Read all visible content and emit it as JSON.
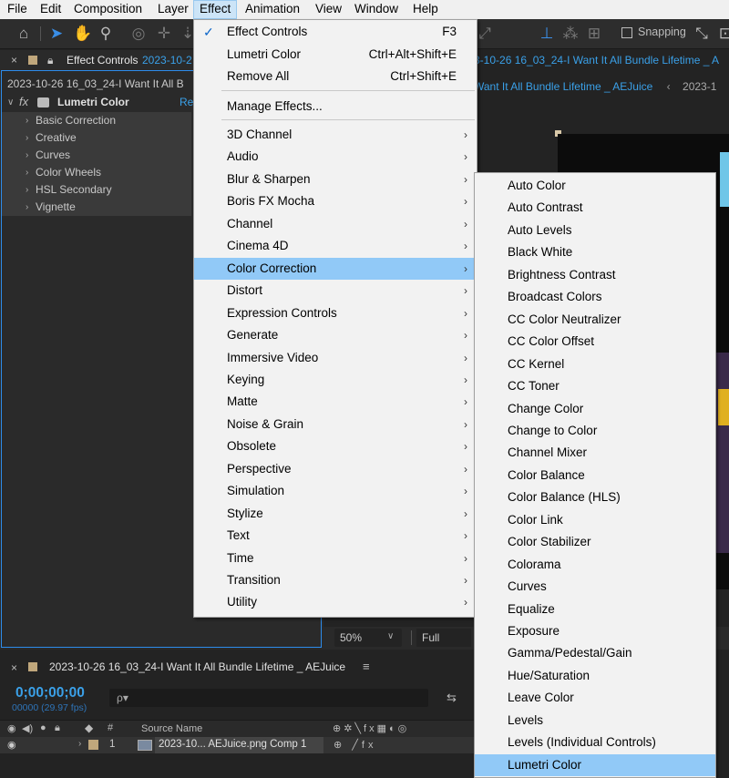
{
  "menubar": {
    "items": [
      "File",
      "Edit",
      "Composition",
      "Layer",
      "Effect",
      "Animation",
      "View",
      "Window",
      "Help"
    ],
    "active": "Effect"
  },
  "toolbar": {
    "snapping_label": "Snapping"
  },
  "effect_controls": {
    "tab_label": "Effect Controls",
    "tab_comp": "2023-10-2",
    "layer_path": "2023-10-26 16_03_24-I Want It All B",
    "fx_label": "fx",
    "effect_name": "Lumetri Color",
    "reset_label": "Re",
    "sections": [
      "Basic Correction",
      "Creative",
      "Curves",
      "Color Wheels",
      "HSL Secondary",
      "Vignette"
    ]
  },
  "composition": {
    "tab_label": "3-10-26 16_03_24-I Want It All Bundle Lifetime _ A",
    "breadcrumb": "Want It All Bundle Lifetime _ AEJuice",
    "breadcrumb_next": "2023-1",
    "zoom": "50%",
    "resolution": "Full"
  },
  "timeline": {
    "title": "2023-10-26 16_03_24-I Want It All Bundle Lifetime _ AEJuice",
    "timecode": "0;00;00;00",
    "frames": "00000 (29.97 fps)",
    "search_placeholder": "ρ▾",
    "col_source_name": "Source Name",
    "layer_index": "1",
    "layer_name": "2023-10... AEJuice.png Comp 1"
  },
  "effect_menu": {
    "top_items": [
      {
        "label": "Effect Controls",
        "shortcut": "F3",
        "checked": true
      },
      {
        "label": "Lumetri Color",
        "shortcut": "Ctrl+Alt+Shift+E"
      },
      {
        "label": "Remove All",
        "shortcut": "Ctrl+Shift+E"
      }
    ],
    "manage": "Manage Effects...",
    "categories": [
      "3D Channel",
      "Audio",
      "Blur & Sharpen",
      "Boris FX Mocha",
      "Channel",
      "Cinema 4D",
      "Color Correction",
      "Distort",
      "Expression Controls",
      "Generate",
      "Immersive Video",
      "Keying",
      "Matte",
      "Noise & Grain",
      "Obsolete",
      "Perspective",
      "Simulation",
      "Stylize",
      "Text",
      "Time",
      "Transition",
      "Utility"
    ],
    "highlighted": "Color Correction"
  },
  "color_correction_menu": {
    "items": [
      "Auto Color",
      "Auto Contrast",
      "Auto Levels",
      "Black  White",
      "Brightness  Contrast",
      "Broadcast Colors",
      "CC Color Neutralizer",
      "CC Color Offset",
      "CC Kernel",
      "CC Toner",
      "Change Color",
      "Change to Color",
      "Channel Mixer",
      "Color Balance",
      "Color Balance (HLS)",
      "Color Link",
      "Color Stabilizer",
      "Colorama",
      "Curves",
      "Equalize",
      "Exposure",
      "Gamma/Pedestal/Gain",
      "Hue/Saturation",
      "Leave Color",
      "Levels",
      "Levels (Individual Controls)",
      "Lumetri Color"
    ],
    "highlighted": "Lumetri Color"
  },
  "colors": {
    "accent_blue": "#2d8ceb",
    "menu_highlight": "#91c9f7",
    "menu_bg": "#f2f2f2"
  }
}
